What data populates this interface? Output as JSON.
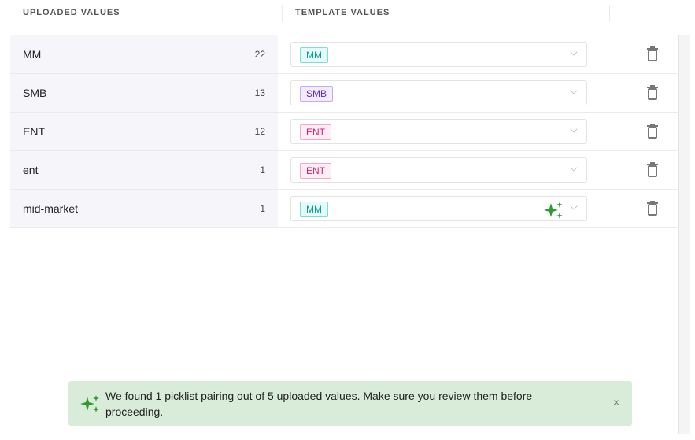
{
  "headers": {
    "uploaded": "UPLOADED VALUES",
    "template": "TEMPLATE VALUES"
  },
  "rows": [
    {
      "value": "MM",
      "count": "22",
      "template": "MM",
      "tag_color": "#0f9b94",
      "tag_bg": "#e4fbf8",
      "tag_border": "#7fdcd3",
      "ai": false
    },
    {
      "value": "SMB",
      "count": "13",
      "template": "SMB",
      "tag_color": "#5b2fc4",
      "tag_bg": "#f3ecff",
      "tag_border": "#c9a9f7",
      "ai": false
    },
    {
      "value": "ENT",
      "count": "12",
      "template": "ENT",
      "tag_color": "#d0216f",
      "tag_bg": "#ffeef5",
      "tag_border": "#f6a8c8",
      "ai": false
    },
    {
      "value": "ent",
      "count": "1",
      "template": "ENT",
      "tag_color": "#d0216f",
      "tag_bg": "#ffeef5",
      "tag_border": "#f6a8c8",
      "ai": false
    },
    {
      "value": "mid-market",
      "count": "1",
      "template": "MM",
      "tag_color": "#0f9b94",
      "tag_bg": "#e4fbf8",
      "tag_border": "#7fdcd3",
      "ai": true
    }
  ],
  "toast": {
    "message": "We found 1 picklist pairing out of 5 uploaded values. Make sure you review them before proceeding.",
    "close": "×",
    "accent": "#2f9a32"
  }
}
